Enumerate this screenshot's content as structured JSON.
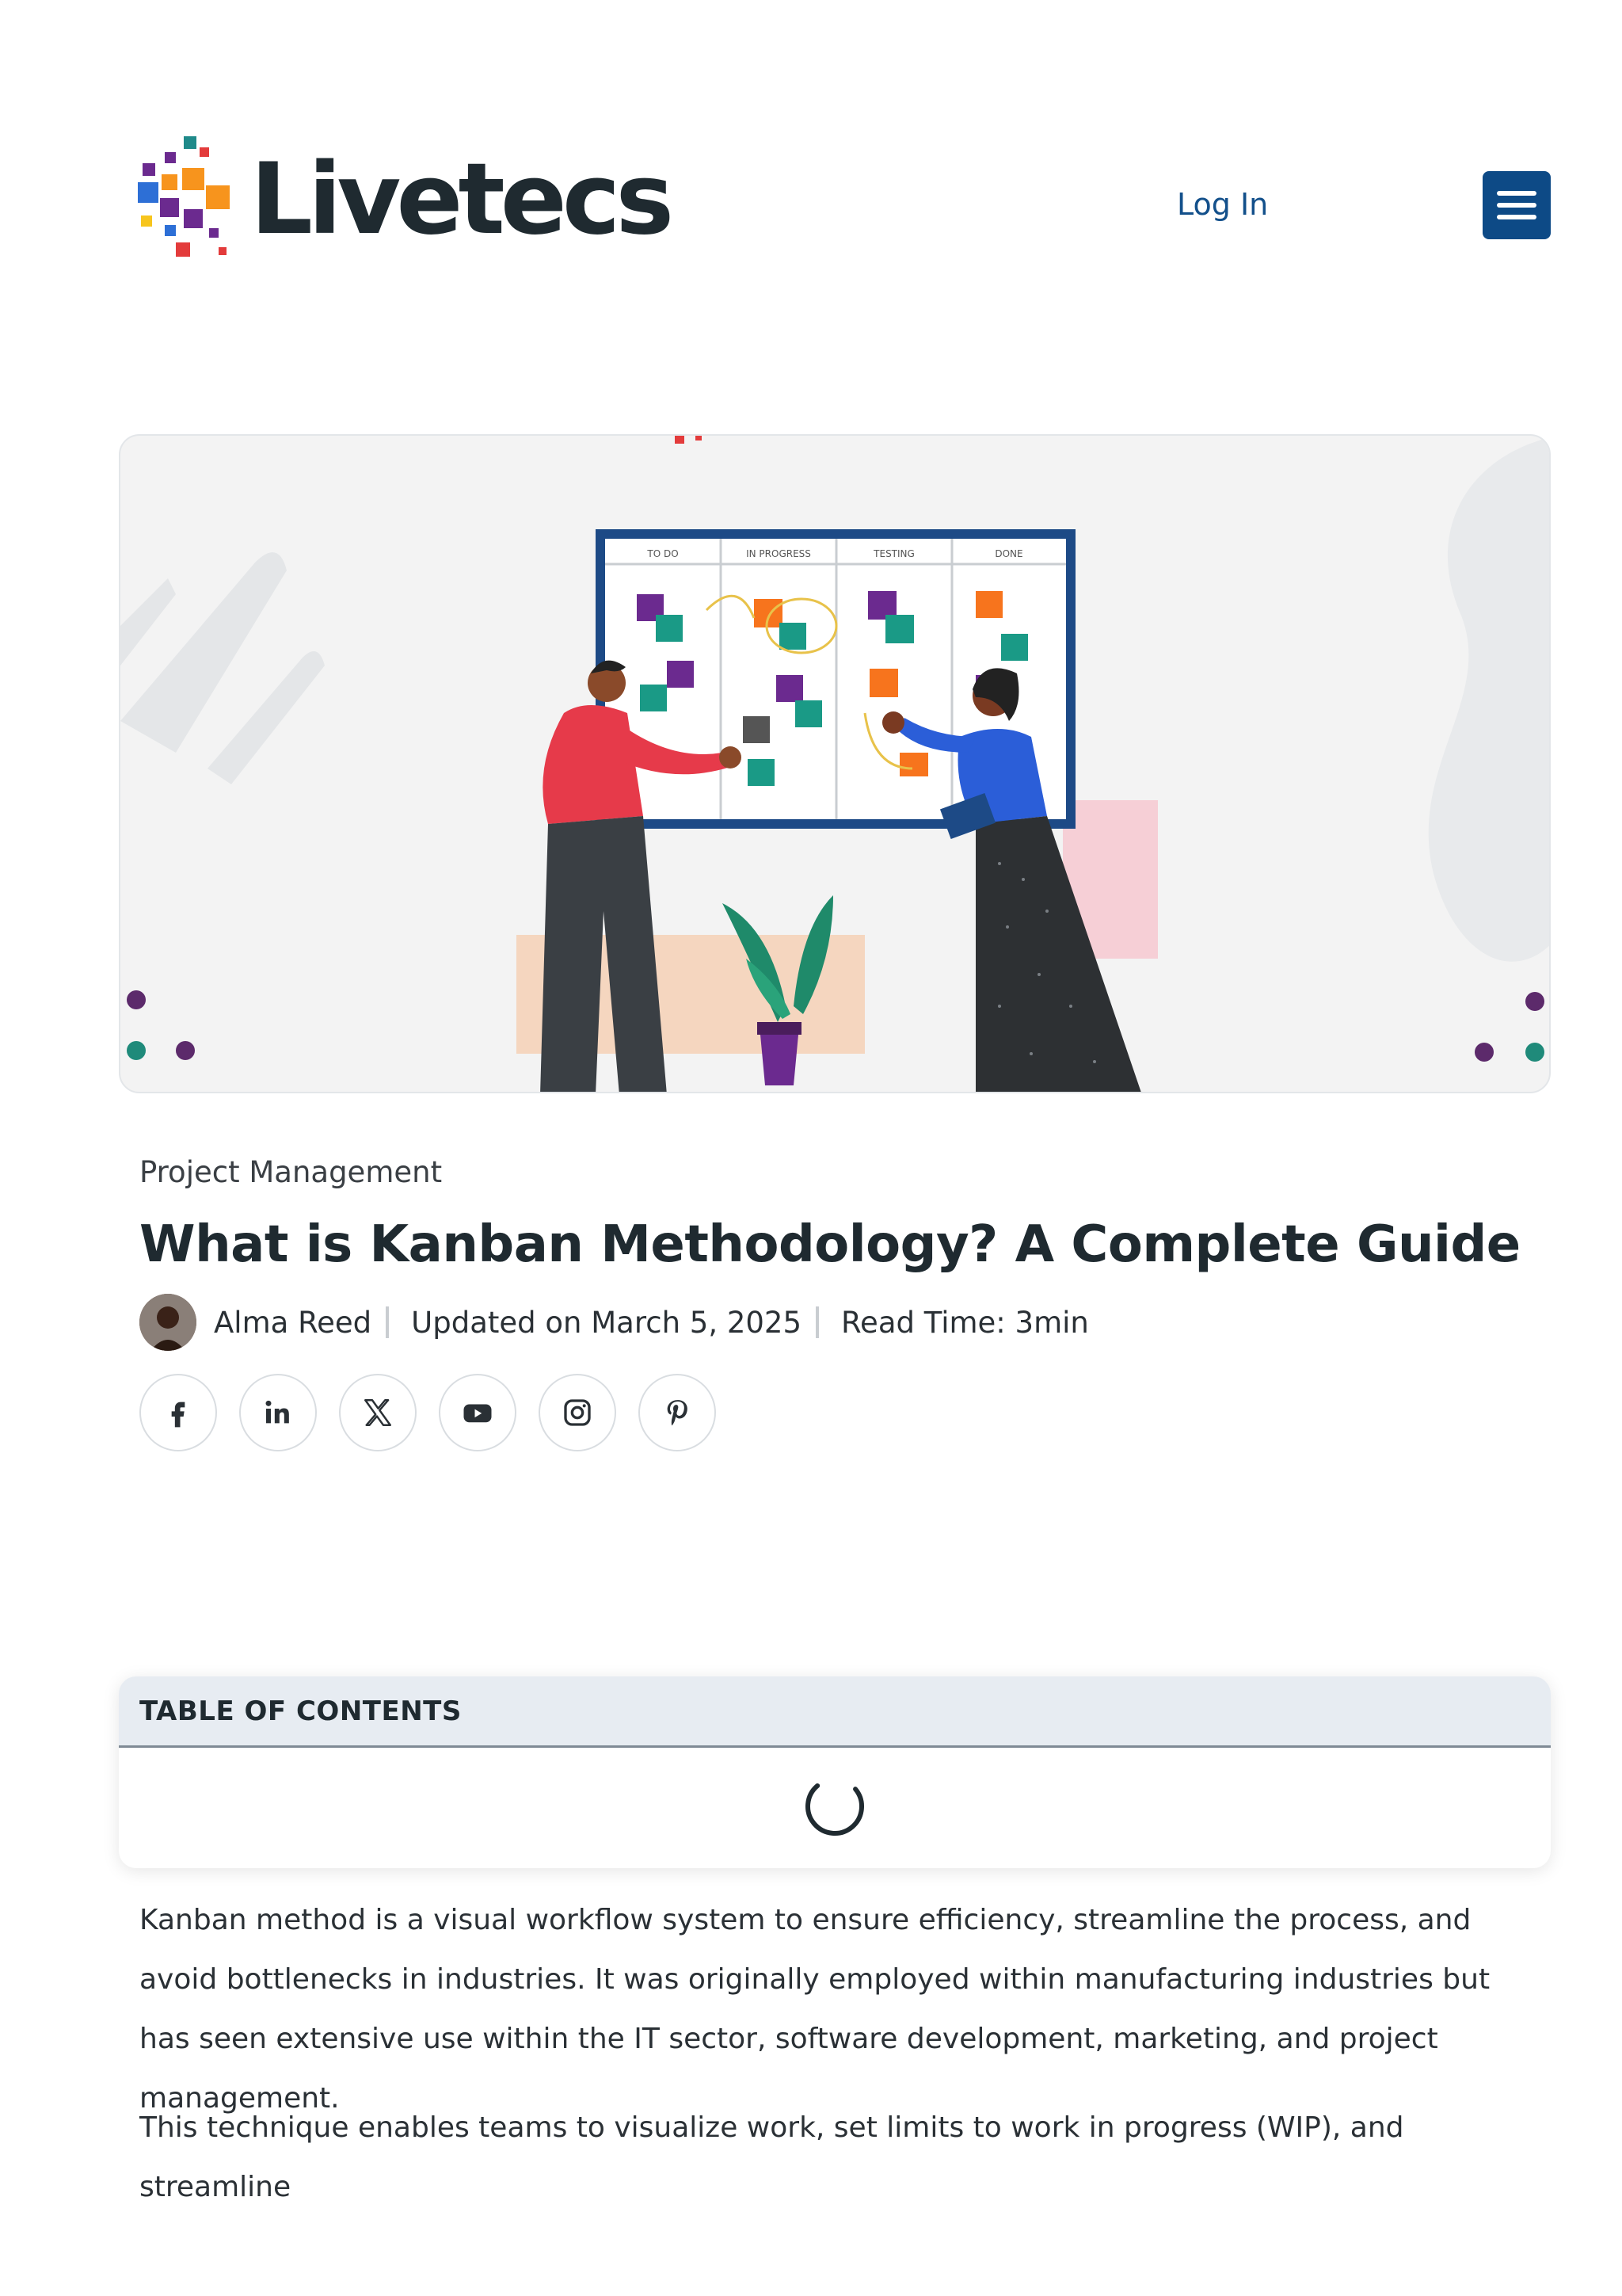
{
  "header": {
    "brand": "Livetecs",
    "login_label": "Log In"
  },
  "hero": {
    "board_columns": [
      "TO DO",
      "IN PROGRESS",
      "TESTING",
      "DONE"
    ]
  },
  "article": {
    "category": "Project Management",
    "title": "What is Kanban Methodology? A Complete Guide",
    "author": "Alma Reed",
    "updated": "Updated on March 5, 2025",
    "read_time": "Read Time: 3min"
  },
  "socials": [
    "facebook-icon",
    "linkedin-icon",
    "x-icon",
    "youtube-icon",
    "instagram-icon",
    "pinterest-icon"
  ],
  "toc": {
    "heading": "TABLE OF CONTENTS"
  },
  "body": {
    "p1": "Kanban method is a visual workflow system to ensure efficiency, streamline the process, and avoid bottlenecks in industries. It was originally employed within manufacturing industries but has seen extensive use within the IT sector, software development, marketing, and project management.",
    "p2": "This technique enables teams to visualize work, set limits to work in progress (WIP), and streamline"
  },
  "colors": {
    "brand_dark": "#1f2a30",
    "link": "#13508b",
    "menu_button": "#0d4a86",
    "toc_header_bg": "#e7ecf2"
  }
}
